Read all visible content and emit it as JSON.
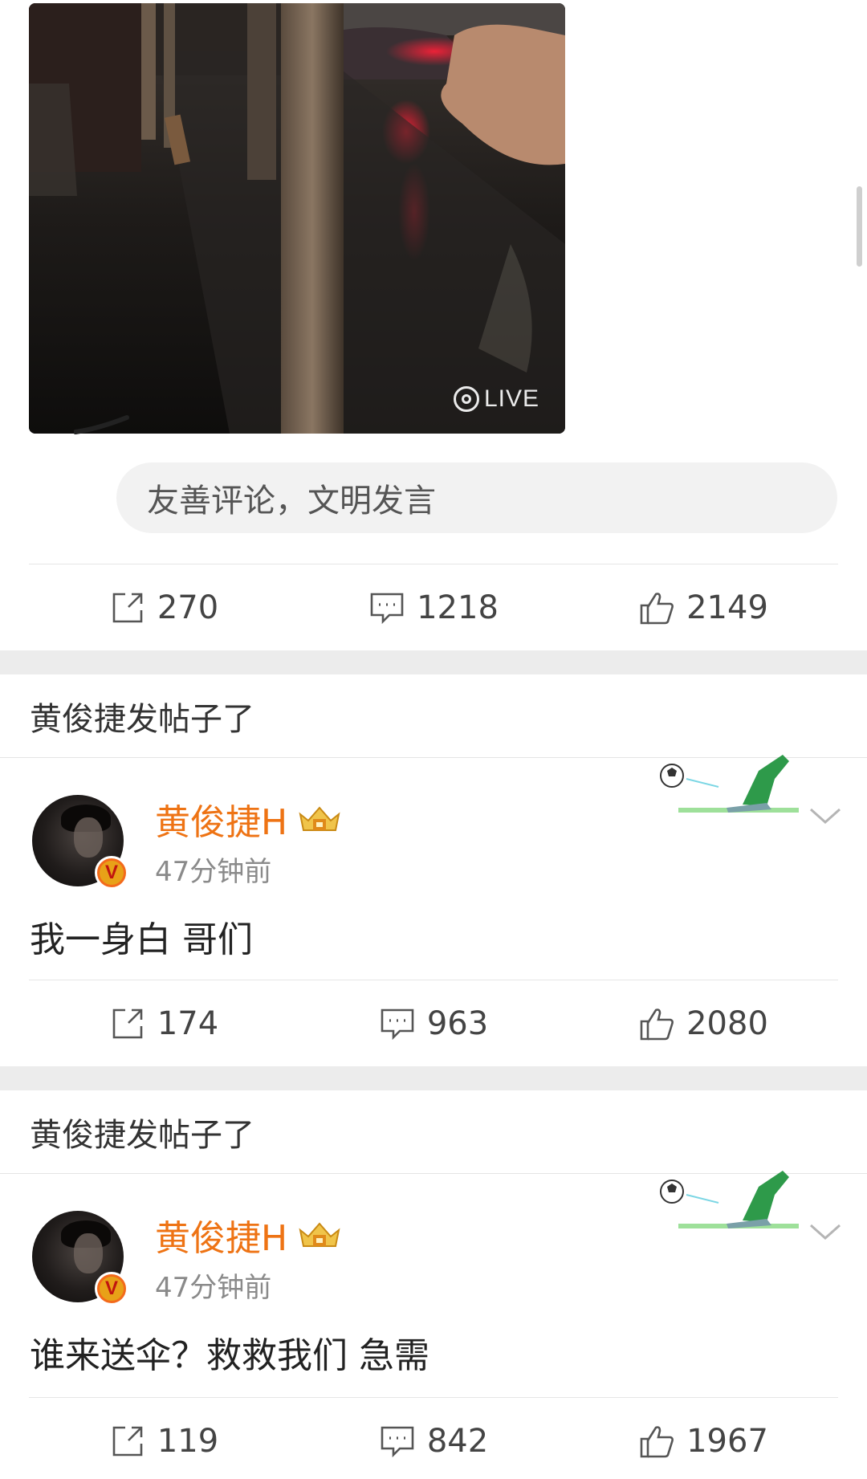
{
  "photo": {
    "live_label": "LIVE"
  },
  "comment": {
    "placeholder": "友善评论，文明发言"
  },
  "top_actions": {
    "reposts": "270",
    "comments": "1218",
    "likes": "2149"
  },
  "posts": [
    {
      "header": "黄俊捷发帖子了",
      "username": "黄俊捷H",
      "time": "47分钟前",
      "text": "我一身白 哥们",
      "reposts": "174",
      "comments": "963",
      "likes": "2080"
    },
    {
      "header": "黄俊捷发帖子了",
      "username": "黄俊捷H",
      "time": "47分钟前",
      "text": "谁来送伞？救救我们 急需",
      "reposts": "119",
      "comments": "842",
      "likes": "1967"
    }
  ],
  "icons": [
    "repost-icon",
    "comment-icon",
    "like-icon",
    "crown-icon",
    "chevron-down-icon",
    "verified-icon",
    "live-icon"
  ],
  "colors": {
    "username": "#ee7314",
    "verified": "#f36a1b",
    "gap": "#ececec"
  }
}
